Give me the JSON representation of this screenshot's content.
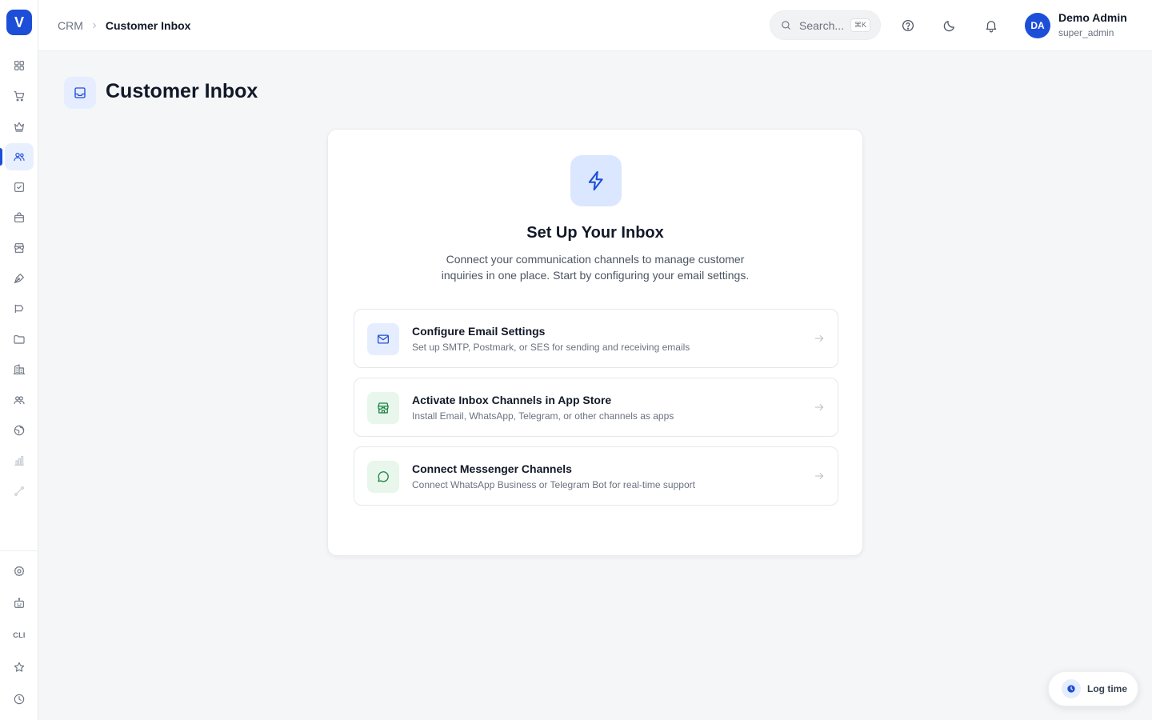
{
  "app": {
    "logo_letter": "V",
    "accent": "#1d4ed8"
  },
  "sidebar": {
    "items": [
      {
        "name": "dashboard",
        "icon": "grid-icon"
      },
      {
        "name": "orders",
        "icon": "cart-icon"
      },
      {
        "name": "loyalty",
        "icon": "crown-icon"
      },
      {
        "name": "crm",
        "icon": "users-icon",
        "active": true
      },
      {
        "name": "tasks",
        "icon": "checkbox-icon"
      },
      {
        "name": "products",
        "icon": "shopping-bag-icon"
      },
      {
        "name": "stores",
        "icon": "store-icon"
      },
      {
        "name": "content",
        "icon": "pen-nib-icon"
      },
      {
        "name": "marketing",
        "icon": "megaphone-icon"
      },
      {
        "name": "files",
        "icon": "folder-icon"
      },
      {
        "name": "companies",
        "icon": "building-icon"
      },
      {
        "name": "teams",
        "icon": "user-group-icon"
      },
      {
        "name": "websites",
        "icon": "globe-icon"
      },
      {
        "name": "analytics",
        "icon": "bar-chart-icon"
      },
      {
        "name": "workflows",
        "icon": "route-icon"
      }
    ],
    "bottom_items": [
      {
        "name": "settings",
        "icon": "gear-icon"
      },
      {
        "name": "bot",
        "icon": "bot-icon"
      },
      {
        "name": "cli",
        "label": "CLI"
      },
      {
        "name": "favorites",
        "icon": "star-icon"
      },
      {
        "name": "history",
        "icon": "clock-icon"
      }
    ]
  },
  "header": {
    "breadcrumb": {
      "root": "CRM",
      "current": "Customer Inbox"
    },
    "search": {
      "placeholder": "Search...",
      "shortcut": "⌘K"
    },
    "icons": [
      "help-icon",
      "moon-icon",
      "bell-icon"
    ],
    "user": {
      "initials": "DA",
      "name": "Demo Admin",
      "role": "super_admin"
    }
  },
  "page": {
    "title": "Customer Inbox"
  },
  "setup": {
    "title": "Set Up Your Inbox",
    "description": "Connect your communication channels to manage customer inquiries in one place. Start by configuring your email settings.",
    "options": [
      {
        "title": "Configure Email Settings",
        "subtitle": "Set up SMTP, Postmark, or SES for sending and receiving emails",
        "icon": "mail-icon",
        "color": "blue"
      },
      {
        "title": "Activate Inbox Channels in App Store",
        "subtitle": "Install Email, WhatsApp, Telegram, or other channels as apps",
        "icon": "store-icon",
        "color": "green"
      },
      {
        "title": "Connect Messenger Channels",
        "subtitle": "Connect WhatsApp Business or Telegram Bot for real-time support",
        "icon": "chat-bubble-icon",
        "color": "green"
      }
    ]
  },
  "log_time": {
    "label": "Log time"
  }
}
